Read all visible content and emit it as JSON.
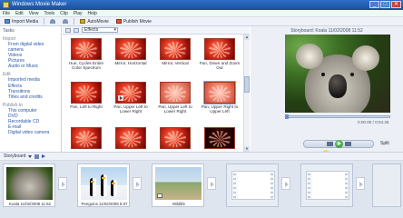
{
  "window": {
    "title": "Windows Movie Maker",
    "controls": [
      "_",
      "□",
      "✕"
    ]
  },
  "menu": [
    "File",
    "Edit",
    "View",
    "Tools",
    "Clip",
    "Play",
    "Help"
  ],
  "toolbar": {
    "import_label": "Import Media",
    "automovie_label": "AutoMovie",
    "publish_label": "Publish Movie"
  },
  "tasks": {
    "title": "Tasks",
    "import_section": "Import",
    "import_links": [
      "From digital video camera",
      "Videos",
      "Pictures",
      "Audio or Music"
    ],
    "edit_section": "Edit",
    "edit_links": [
      "Imported media",
      "Effects",
      "Transitions",
      "Titles and credits"
    ],
    "publish_section": "Publish to",
    "publish_links": [
      "This computer",
      "DVD",
      "Recordable CD",
      "E-mail",
      "Digital video camera"
    ]
  },
  "collection": {
    "dropdown_value": "Effects"
  },
  "effects": [
    {
      "label": "Hue, Cycles Entire Color Spectrum"
    },
    {
      "label": "Mirror, Horizontal"
    },
    {
      "label": "Mirror, Vertical"
    },
    {
      "label": "Pan, Down and Zoom Out"
    },
    {
      "label": "Pan, Left to Right"
    },
    {
      "label": "Pan, Upper Left to Lower Right"
    },
    {
      "label": "Pan, Upper Left to Lower Right"
    },
    {
      "label": "Pan, Upper Right to Upper Left"
    },
    {
      "label": ""
    },
    {
      "label": ""
    },
    {
      "label": ""
    },
    {
      "label": ""
    }
  ],
  "preview": {
    "title": "Storyboard: Koala 11/02/2008 11:52",
    "timecode": "0:00.00 / 0:04.25",
    "split_label": "Split"
  },
  "storyboard": {
    "label": "Storyboard",
    "clips": [
      {
        "label": "Koala 11/02/2008 11:52"
      },
      {
        "label": "Penguins 11/02/2008 5:07"
      },
      {
        "label": "Wildlife"
      }
    ]
  },
  "colors": {
    "accent": "#2f6fc5",
    "effect_red": "#e63c24",
    "play_green": "#1f8a2a"
  }
}
